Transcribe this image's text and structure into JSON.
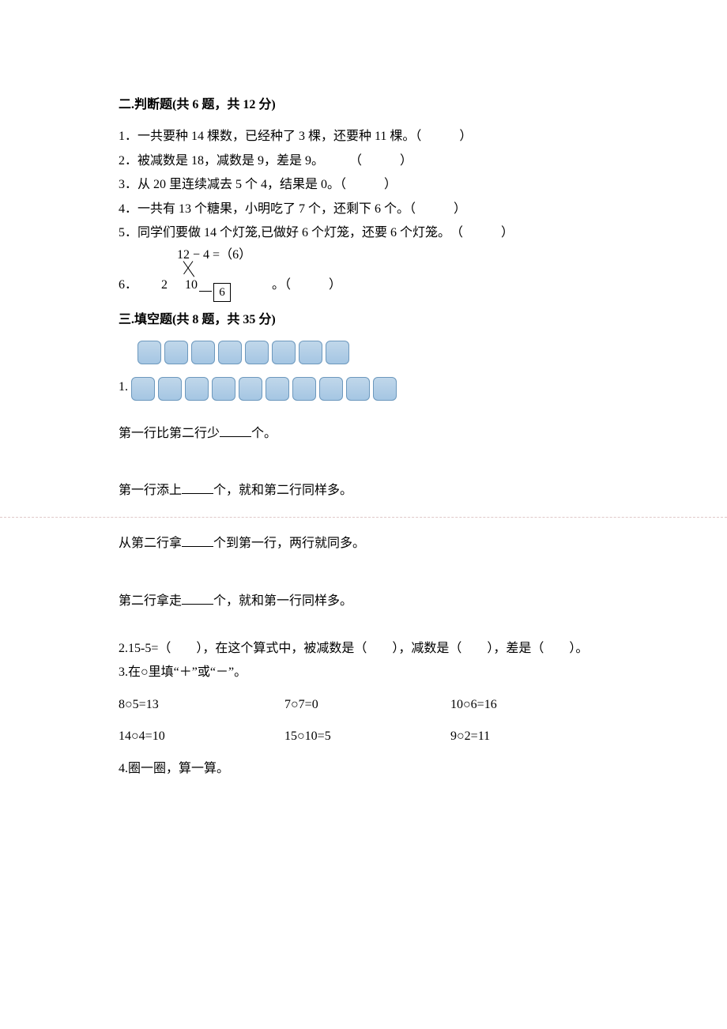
{
  "section2": {
    "title": "二.判断题(共 6 题，共 12 分)",
    "q1": "1．一共要种 14 棵数，已经种了 3 棵，还要种 11 棵。（　　　）",
    "q2": "2．被减数是 18，减数是 9，差是 9。　　　（　　　）",
    "q3": "3．从 20 里连续减去 5 个 4，结果是 0。（　　　）",
    "q4": "4．一共有 13 个糖果，小明吃了 7 个，还剩下 6 个。（　　　）",
    "q5": "5．同学们要做 14 个灯笼,已做好 6 个灯笼，还要 6 个灯笼。　（　　　）",
    "q6": {
      "prefix": "6．",
      "expr": "12 − 4 =（6）",
      "left": "2",
      "mid": "10",
      "box": "6",
      "suffix": "。（　　　）"
    }
  },
  "section3": {
    "title": "三.填空题(共 8 题，共 35 分)",
    "q1": {
      "prefix": "1.",
      "row1_count": 8,
      "row2_count": 10,
      "sub1_a": "第一行比第二行少",
      "sub1_b": "个。",
      "sub2_a": "第一行添上",
      "sub2_b": "个，就和第二行同样多。",
      "sub3_a": "从第二行拿",
      "sub3_b": "个到第一行，两行就同多。",
      "sub4_a": "第二行拿走",
      "sub4_b": "个，就和第一行同样多。"
    },
    "q2": "2.15-5=（　　），在这个算式中，被减数是（　　），减数是（　　），差是（　　）。",
    "q3": {
      "title": "3.在○里填“＋”或“－”。",
      "row1": {
        "a": "8○5=13",
        "b": "7○7=0",
        "c": "10○6=16"
      },
      "row2": {
        "a": "14○4=10",
        "b": "15○10=5",
        "c": "9○2=11"
      }
    },
    "q4": "4.圈一圈，算一算。"
  }
}
